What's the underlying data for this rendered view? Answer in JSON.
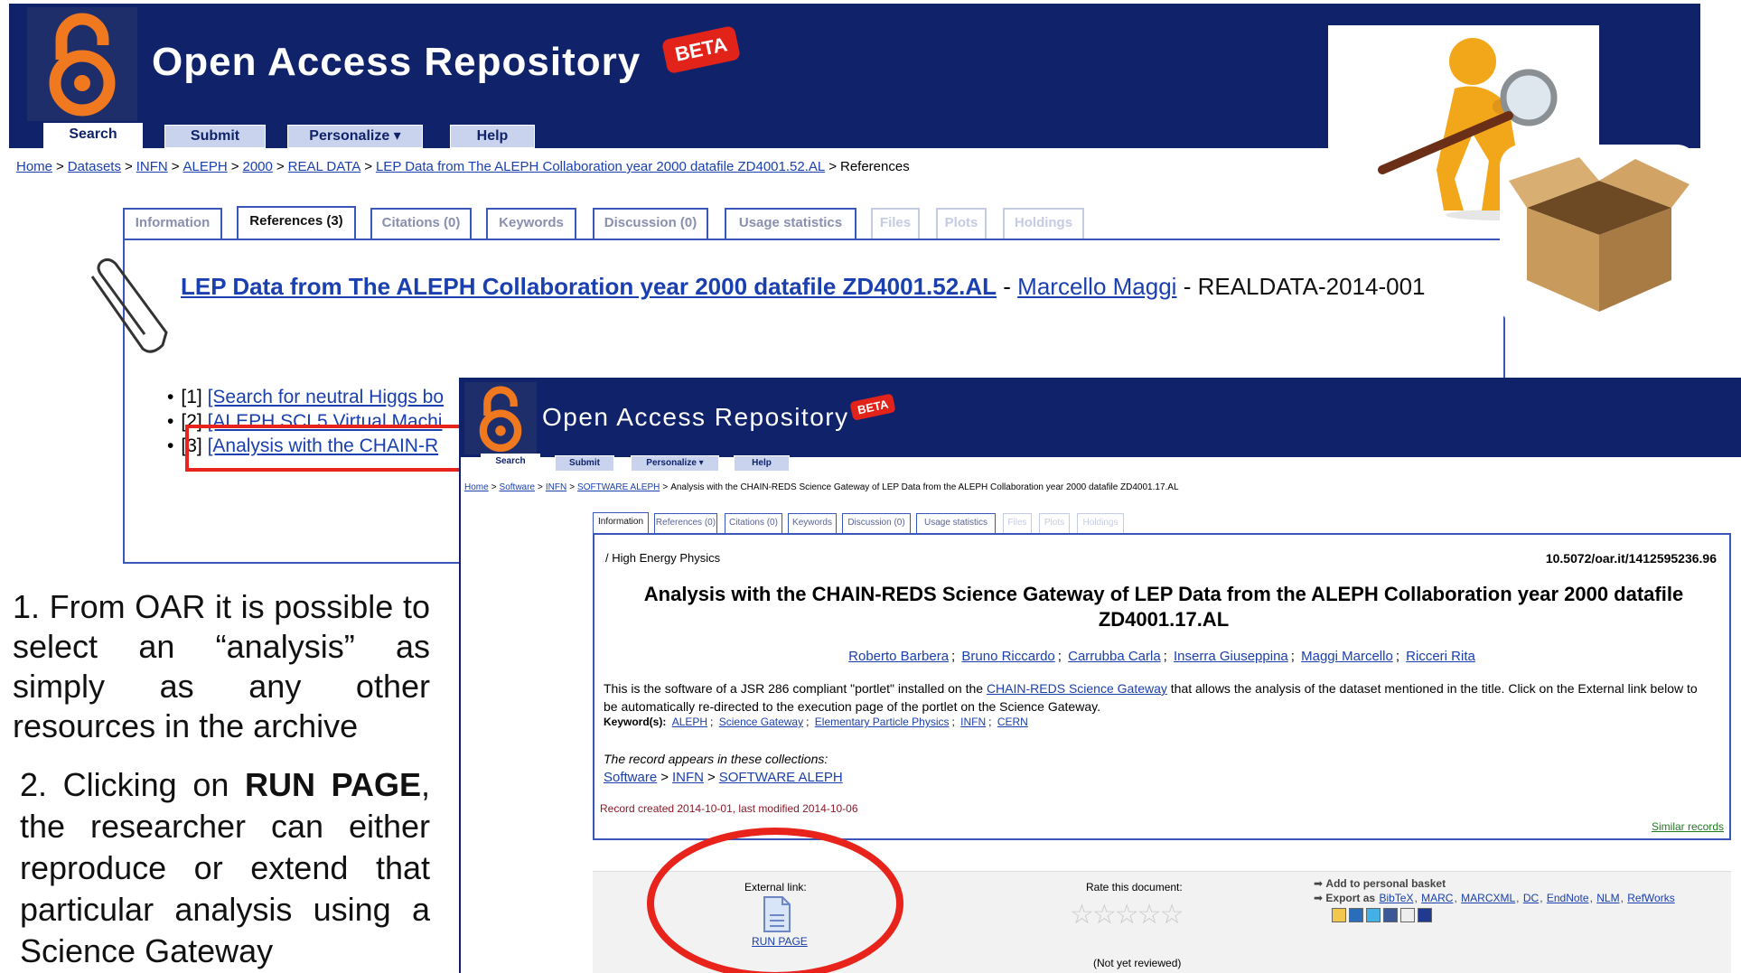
{
  "back": {
    "title": "Open Access Repository",
    "beta": "BETA",
    "nav": [
      "Search",
      "Submit",
      "Personalize ▾",
      "Help"
    ],
    "breadcrumb": [
      {
        "text": "Home",
        "link": true
      },
      {
        "text": "Datasets",
        "link": true
      },
      {
        "text": "INFN",
        "link": true
      },
      {
        "text": "ALEPH",
        "link": true
      },
      {
        "text": "2000",
        "link": true
      },
      {
        "text": "REAL DATA",
        "link": true
      },
      {
        "text": "LEP Data from The ALEPH Collaboration year 2000 datafile ZD4001.52.AL",
        "link": true
      },
      {
        "text": "References",
        "link": false
      }
    ],
    "tabs": [
      "Information",
      "References (3)",
      "Citations (0)",
      "Keywords",
      "Discussion (0)",
      "Usage statistics",
      "Files",
      "Plots",
      "Holdings"
    ],
    "record": {
      "title": "LEP Data from The ALEPH Collaboration year 2000 datafile ZD4001.52.AL",
      "dash1": " - ",
      "author": "Marcello Maggi",
      "dash2": " - ",
      "id": "REALDATA-2014-001"
    },
    "references": [
      {
        "num": "[1]",
        "text": "[Search for neutral Higgs bo"
      },
      {
        "num": "[2]",
        "text": "[ALEPH SCL5 Virtual Machi"
      },
      {
        "num": "[3]",
        "text": "[Analysis with the CHAIN-R"
      }
    ]
  },
  "instructions": {
    "step1": "1. From OAR it is possible to select an “analysis” as simply as any other resources in the archive",
    "step2_pre": "2. Clicking on ",
    "step2_bold": "RUN PAGE",
    "step2_post": ", the researcher can either reproduce or extend that particular analysis using a Science Gateway"
  },
  "front": {
    "title": "Open Access Repository",
    "beta": "BETA",
    "nav": [
      "Search",
      "Submit",
      "Personalize ▾",
      "Help"
    ],
    "breadcrumb": [
      {
        "text": "Home",
        "link": true
      },
      {
        "text": "Software",
        "link": true
      },
      {
        "text": "INFN",
        "link": true
      },
      {
        "text": "SOFTWARE ALEPH",
        "link": true
      },
      {
        "text": "Analysis with the CHAIN-REDS Science Gateway of LEP Data from the ALEPH Collaboration year 2000 datafile ZD4001.17.AL",
        "link": false
      }
    ],
    "tabs": [
      "Information",
      "References (0)",
      "Citations (0)",
      "Keywords",
      "Discussion (0)",
      "Usage statistics",
      "Files",
      "Plots",
      "Holdings"
    ],
    "collection": "/ High Energy Physics",
    "doi": "10.5072/oar.it/1412595236.96",
    "record_title": "Analysis with the CHAIN-REDS Science Gateway of LEP Data from the ALEPH Collaboration year 2000 datafile ZD4001.17.AL",
    "authors": [
      "Roberto Barbera",
      "Bruno Riccardo",
      "Carrubba Carla",
      "Inserra Giuseppina",
      "Maggi Marcello",
      "Ricceri Rita"
    ],
    "abstract_pre": "This is the software of a JSR 286 compliant \"portlet\" installed on the ",
    "abstract_link": "CHAIN-REDS Science Gateway",
    "abstract_post": " that allows the analysis of the dataset mentioned in the title. Click on the External link below to be automatically re-directed to the execution page of the portlet on the Science Gateway.",
    "keywords_label": "Keyword(s):",
    "keywords": [
      "ALEPH",
      "Science Gateway",
      "Elementary Particle Physics",
      "INFN",
      "CERN"
    ],
    "collections_label": "The record appears in these collections:",
    "collections_path": [
      "Software",
      "INFN",
      "SOFTWARE ALEPH"
    ],
    "created": "Record created 2014-10-01, last modified 2014-10-06",
    "similar": "Similar records",
    "external_link": "External link:",
    "run_page": "RUN PAGE",
    "rate_label": "Rate this document:",
    "stars": "☆☆☆☆☆",
    "not_reviewed": "(Not yet reviewed)",
    "basket": "Add to personal basket",
    "export_label": "Export as",
    "export_formats": [
      "BibTeX",
      "MARC",
      "MARCXML",
      "DC",
      "EndNote",
      "NLM",
      "RefWorks"
    ]
  },
  "colors": {
    "header_navy": "#10236a",
    "beta_red": "#e2231a",
    "highlight_red": "#e8231c",
    "link_blue": "#1a3fae",
    "logo_orange": "#f0781e"
  },
  "icons": [
    "open-access-lock-icon",
    "paperclip-icon",
    "magnifying-figure-icon",
    "cardboard-box-icon",
    "document-icon",
    "star-icon",
    "arrow-icon"
  ]
}
